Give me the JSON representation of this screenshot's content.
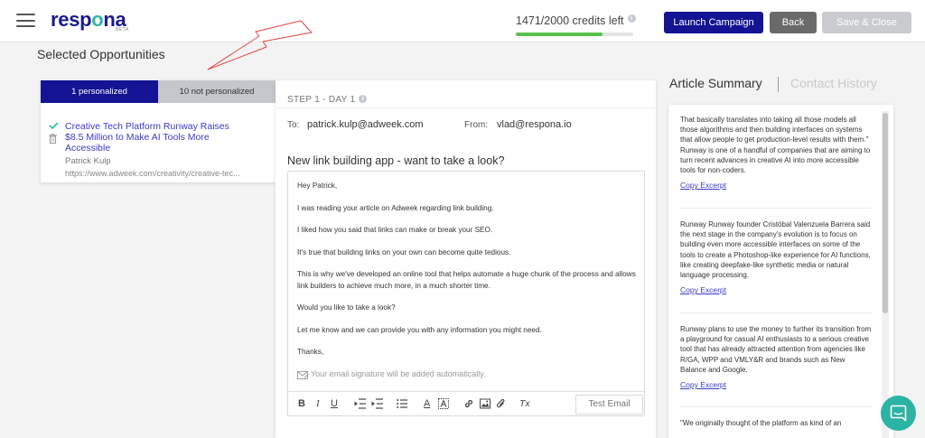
{
  "header": {
    "logo": "resp",
    "logo_o": "o",
    "logo_end": "na",
    "logo_beta": "BETA",
    "credits_text": "1471/2000 credits left",
    "credits_info": "i",
    "credits_used_fraction": 0.735,
    "launch_label": "Launch Campaign",
    "back_label": "Back",
    "save_label": "Save & Close"
  },
  "page": {
    "title": "Selected Opportunities"
  },
  "opportunities": {
    "tab_personalized": "1 personalized",
    "tab_not_personalized": "10 not personalized",
    "items": [
      {
        "title": "Creative Tech Platform Runway Raises $8.5 Million to Make AI Tools More Accessible",
        "author": "Patrick Kulp",
        "url": "https://www.adweek.com/creativity/creative-tec..."
      }
    ]
  },
  "email": {
    "step": "STEP 1 - DAY 1",
    "step_info": "i",
    "to_label": "To:",
    "to_value": "patrick.kulp@adweek.com",
    "from_label": "From:",
    "from_value": "vlad@respona.io",
    "subject": "New link building app - want to take a look?",
    "body": [
      "Hey Patrick,",
      "I was reading your article on Adweek regarding link building.",
      "I liked how you said that links can make or break your SEO.",
      "It's true that building links on your own can become quite tedious.",
      "This is why we've developed an online tool that helps automate a huge chunk of the process and allows link builders to achieve much more, in a much shorter time.",
      "Would you like to take a look?",
      "Let me know and we can provide you with any information you might need.",
      "Thanks,"
    ],
    "signature_note": "Your email signature will be added automatically.",
    "toolbar": {
      "bold": "B",
      "italic": "I",
      "underline": "U",
      "text_color": "A",
      "clear_format": "Tx",
      "test_email": "Test Email"
    }
  },
  "article": {
    "tab_summary": "Article Summary",
    "tab_history": "Contact History",
    "copy_label": "Copy Excerpt",
    "excerpts": [
      "That basically translates into taking all those models all those algorithms and then building interfaces on systems that allow people to get production-level results with them.\" Runway is one of a handful of companies that are aiming to turn recent advances in creative AI into more accessible tools for non-coders.",
      "Runway Runway founder Cristóbal Valenzuela Barrera said the next stage in the company's evolution is to focus on building even more accessible interfaces on some of the tools to create a Photoshop-like experience for AI functions, like creating deepfake-like synthetic media or natural language processing.",
      "Runway plans to use the money to further its transition from a playground for casual AI enthusiasts to a serious creative tool that has already attracted attention from agencies like R/GA, WPP and VMLY&R and brands such as New Balance and Google.",
      "\"We originally thought of the platform as kind of an"
    ]
  }
}
